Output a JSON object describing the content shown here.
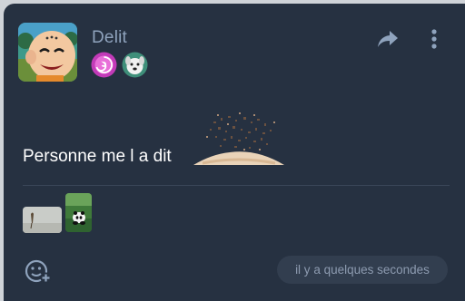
{
  "post": {
    "author": "Delit",
    "message": "Personne me l a dit",
    "timestamp": "il y a quelques secondes",
    "badges": [
      "purple-swirl-badge",
      "dog-face-badge"
    ],
    "attachments": [
      "bird-photo-thumbnail",
      "panda-photo-thumbnail"
    ]
  },
  "icons": {
    "share": "share-arrow-icon",
    "more": "vertical-dots-icon",
    "react": "add-emoji-icon"
  },
  "colors": {
    "card_background": "#263141",
    "username": "#8fa3bd",
    "message_text": "#ffffff",
    "timestamp_pill": "#323e4f",
    "timestamp_text": "#8d9bb0",
    "icon": "#8fa3bd"
  }
}
